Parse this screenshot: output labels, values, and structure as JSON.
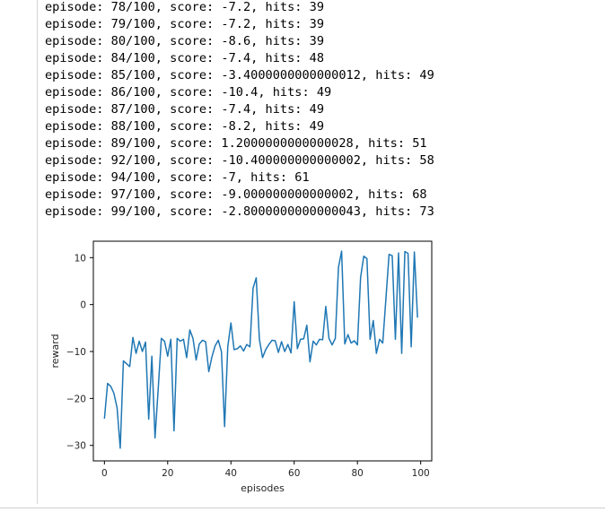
{
  "output": {
    "lines": [
      "episode: 78/100, score: -7.2, hits: 39",
      "episode: 79/100, score: -7.2, hits: 39",
      "episode: 80/100, score: -8.6, hits: 39",
      "episode: 84/100, score: -7.4, hits: 48",
      "episode: 85/100, score: -3.4000000000000012, hits: 49",
      "episode: 86/100, score: -10.4, hits: 49",
      "episode: 87/100, score: -7.4, hits: 49",
      "episode: 88/100, score: -8.2, hits: 49",
      "episode: 89/100, score: 1.2000000000000028, hits: 51",
      "episode: 92/100, score: -10.400000000000002, hits: 58",
      "episode: 94/100, score: -7, hits: 61",
      "episode: 97/100, score: -9.000000000000002, hits: 68",
      "episode: 99/100, score: -2.8000000000000043, hits: 73"
    ]
  },
  "chart_data": {
    "type": "line",
    "xlabel": "episodes",
    "ylabel": "reward",
    "xlim": [
      -3.5,
      103.5
    ],
    "ylim": [
      -33.3,
      13.5
    ],
    "xticks": [
      0,
      20,
      40,
      60,
      80,
      100
    ],
    "yticks": [
      10,
      0,
      -10,
      -20,
      -30
    ],
    "ytick_labels": [
      "10",
      "0",
      "−10",
      "−20",
      "−30"
    ],
    "grid": false,
    "line_color": "#1f77b4",
    "series": [
      {
        "x": [
          0,
          1,
          2,
          3,
          4,
          5,
          6,
          7,
          8,
          9,
          10,
          11,
          12,
          13,
          14,
          15,
          16,
          17,
          18,
          19,
          20,
          21,
          22,
          23,
          24,
          25,
          26,
          27,
          28,
          29,
          30,
          31,
          32,
          33,
          34,
          35,
          36,
          37,
          38,
          39,
          40,
          41,
          42,
          43,
          44,
          45,
          46,
          47,
          48,
          49,
          50,
          51,
          52,
          53,
          54,
          55,
          56,
          57,
          58,
          59,
          60,
          61,
          62,
          63,
          64,
          65,
          66,
          67,
          68,
          69,
          70,
          71,
          72,
          73,
          74,
          75,
          76,
          77,
          78,
          79,
          80,
          81,
          82,
          83,
          84,
          85,
          86,
          87,
          88,
          89,
          90,
          91,
          92,
          93,
          94,
          95,
          96,
          97,
          98,
          99
        ],
        "y": [
          -24.3,
          -16.8,
          -17.4,
          -18.9,
          -22.0,
          -30.6,
          -12.0,
          -12.6,
          -13.2,
          -7.0,
          -10.4,
          -7.8,
          -10.0,
          -8.0,
          -24.4,
          -11.0,
          -28.4,
          -18.0,
          -7.2,
          -7.8,
          -11.0,
          -7.4,
          -26.9,
          -7.2,
          -7.8,
          -7.4,
          -11.3,
          -5.4,
          -7.2,
          -11.8,
          -8.4,
          -7.6,
          -7.9,
          -14.3,
          -11.1,
          -8.8,
          -7.6,
          -10.0,
          -26.0,
          -9.0,
          -3.9,
          -9.6,
          -9.4,
          -8.8,
          -9.9,
          -8.5,
          -9.0,
          3.5,
          5.7,
          -7.4,
          -11.3,
          -9.6,
          -8.5,
          -7.6,
          -7.7,
          -10.2,
          -7.9,
          -10.0,
          -8.5,
          -10.3,
          0.6,
          -9.4,
          -7.4,
          -7.3,
          -4.4,
          -12.2,
          -7.8,
          -8.6,
          -7.4,
          -7.5,
          -0.4,
          -7.2,
          -8.6,
          -7.2,
          7.9,
          11.4,
          -8.4,
          -6.4,
          -8.2,
          -7.7,
          -8.6,
          5.8,
          10.3,
          9.8,
          -7.4,
          -3.4,
          -10.4,
          -7.4,
          -8.2,
          1.2,
          10.7,
          10.4,
          -7.4,
          11.0,
          -10.4,
          11.3,
          10.9,
          -9.0,
          11.2,
          -2.8
        ]
      }
    ]
  }
}
